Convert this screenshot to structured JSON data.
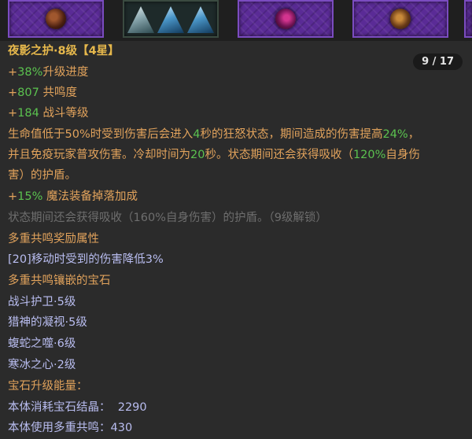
{
  "gem_slots": [
    {
      "icon": "dark-orb-gem-icon"
    },
    {
      "icon": "triple-crystal-icon"
    },
    {
      "icon": "crimson-orb-gem-icon"
    },
    {
      "icon": "amber-orb-gem-icon"
    }
  ],
  "page_indicator": "9 / 17",
  "item": {
    "title": "夜影之护·8级【4星】",
    "stats": [
      {
        "plus": "+",
        "value": "38%",
        "label": "升级进度"
      },
      {
        "plus": "+",
        "value": "807",
        "label": " 共鸣度"
      },
      {
        "plus": "+",
        "value": "184",
        "label": " 战斗等级"
      }
    ],
    "desc": {
      "l1a": "生命值低于50%时受到伤害后会进入",
      "l1b": "4",
      "l1c": "秒的狂怒状态，期间造成的伤害提高",
      "l1d": "24%",
      "l1e": "，",
      "l2a": "并且免疫玩家普攻伤害。冷却时间为",
      "l2b": "20",
      "l2c": "秒。状态期间还会获得吸收（",
      "l2d": "120%",
      "l2e": "自身伤",
      "l3": "害）的护盾。"
    },
    "magic_drop": {
      "plus": "+",
      "value": "15%",
      "label": " 魔法装备掉落加成"
    },
    "locked_text": "状态期间还会获得吸收（160%自身伤害）的护盾。（9级解锁）",
    "resonance_reward_header": "多重共鸣奖励属性",
    "resonance_reward": "[20]移动时受到的伤害降低3%",
    "inlaid_header": "多重共鸣镶嵌的宝石",
    "inlaid_gems": [
      "战斗护卫·5级",
      "猎神的凝视·5级",
      "蝮蛇之噬·6级",
      "寒冰之心·2级"
    ],
    "upgrade_header": "宝石升级能量：",
    "upgrade_crystal": "本体消耗宝石结晶：  2290",
    "upgrade_resonance": "本体使用多重共鸣：430"
  },
  "colors": {
    "title": "#e6b84c",
    "text_orange": "#e2a35c",
    "number_green": "#5bc24f",
    "locked_gray": "#6e6e6e",
    "gem_blue": "#b9bdf0",
    "panel_bg": "#2b2b2b",
    "slot_purple": "#5a2b96"
  }
}
